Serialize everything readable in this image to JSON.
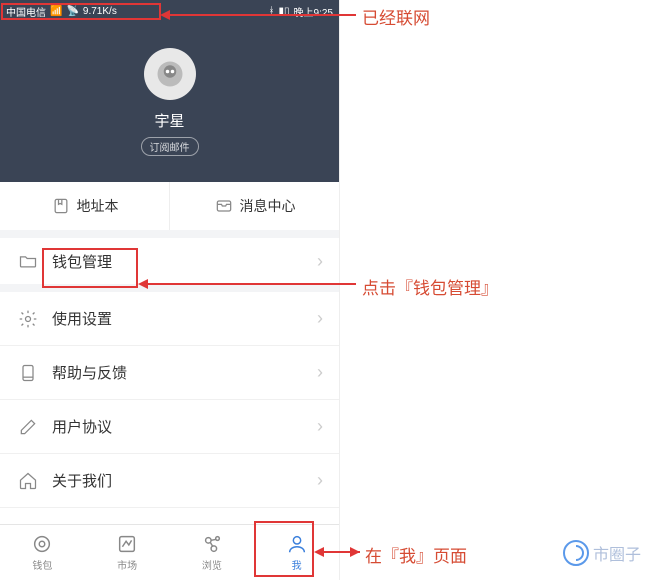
{
  "status_bar": {
    "carrier": "中国电信",
    "net_speed": "9.71K/s",
    "time": "晚上9:25"
  },
  "profile": {
    "username": "宇星",
    "subscribe_label": "订阅邮件"
  },
  "quick": {
    "address_book": "地址本",
    "message_center": "消息中心"
  },
  "menu": {
    "wallet_manage": "钱包管理",
    "usage_settings": "使用设置",
    "help_feedback": "帮助与反馈",
    "user_agreement": "用户协议",
    "about_us": "关于我们"
  },
  "tabs": {
    "wallet": "钱包",
    "market": "市场",
    "browse": "浏览",
    "me": "我"
  },
  "annotations": {
    "networked": "已经联网",
    "click_wallet": "点击『钱包管理』",
    "in_me_page": "在『我』页面"
  },
  "watermark": "市圈子"
}
